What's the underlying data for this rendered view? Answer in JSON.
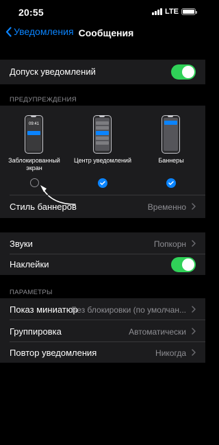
{
  "status_bar": {
    "time": "20:55",
    "network": "LTE"
  },
  "nav": {
    "back_label": "Уведомления",
    "title": "Сообщения"
  },
  "allow_notifications": {
    "label": "Допуск уведомлений",
    "enabled": true
  },
  "alerts": {
    "header": "ПРЕДУПРЕЖДЕНИЯ",
    "lock_screen": {
      "label_line1": "Заблокированный",
      "label_line2": "экран",
      "clock": "09:41",
      "checked": false
    },
    "notification_center": {
      "label": "Центр уведомлений",
      "checked": true
    },
    "banners": {
      "label": "Баннеры",
      "checked": true
    }
  },
  "banner_style": {
    "label": "Стиль баннеров",
    "value": "Временно"
  },
  "sounds": {
    "label": "Звуки",
    "value": "Попкорн"
  },
  "badges": {
    "label": "Наклейки",
    "enabled": true
  },
  "options": {
    "header": "ПАРАМЕТРЫ",
    "show_previews": {
      "label": "Показ миниатюр",
      "value": "Без блокировки (по умолчан..."
    },
    "grouping": {
      "label": "Группировка",
      "value": "Автоматически"
    },
    "repeat": {
      "label": "Повтор уведомления",
      "value": "Никогда"
    }
  },
  "colors": {
    "accent": "#0a84ff",
    "toggle_on": "#30d158",
    "cell_bg": "#1c1c1e",
    "secondary_text": "#8e8e93"
  }
}
